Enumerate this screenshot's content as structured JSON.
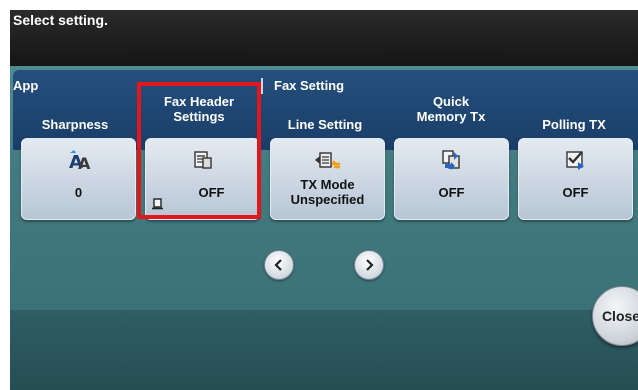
{
  "message": "Select setting.",
  "groups": {
    "app": "App",
    "fax_setting": "Fax Setting"
  },
  "columns": [
    {
      "label": "Sharpness",
      "value": "0",
      "icon": "sharpness-icon"
    },
    {
      "label": "Fax Header\nSettings",
      "value": "OFF",
      "icon": "fax-header-icon",
      "badge_icon": "indicator-icon"
    },
    {
      "label": "Line Setting",
      "value": "TX Mode\nUnspecified",
      "icon": "line-setting-icon"
    },
    {
      "label": "Quick\nMemory Tx",
      "value": "OFF",
      "icon": "quick-memory-tx-icon"
    },
    {
      "label": "Polling TX",
      "value": "OFF",
      "icon": "polling-tx-icon"
    }
  ],
  "close_label": "Close",
  "colors": {
    "highlight": "#e3161c",
    "panel": "#437b81",
    "header": "#1a3e68"
  }
}
